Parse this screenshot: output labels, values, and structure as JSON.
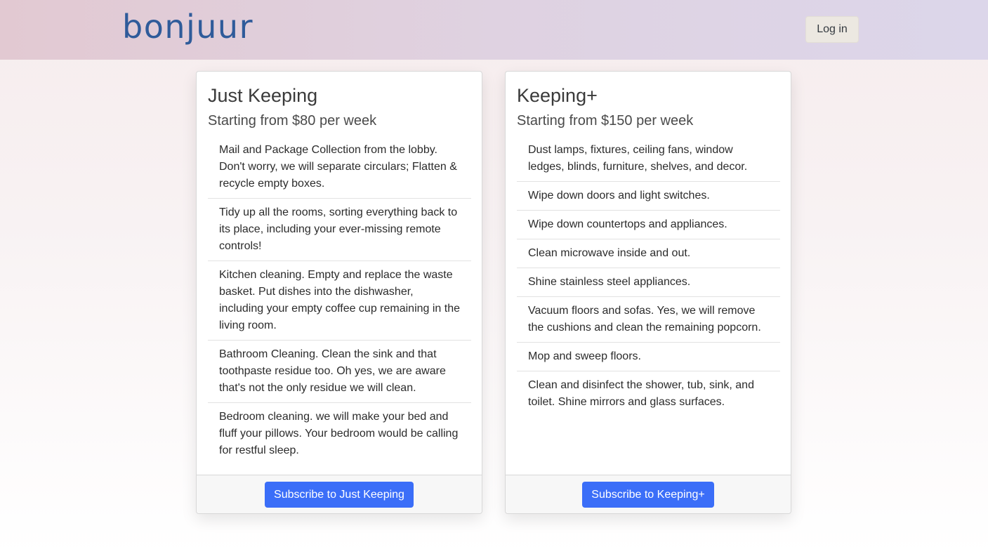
{
  "header": {
    "logo_text": "bonjuur",
    "login_label": "Log in"
  },
  "plans": [
    {
      "title": "Just Keeping",
      "subtitle": "Starting from $80 per week",
      "features": [
        "Mail and Package Collection from the lobby. Don't worry, we will separate circulars; Flatten & recycle empty boxes.",
        "Tidy up all the rooms, sorting everything back to its place, including your ever-missing remote controls!",
        "Kitchen cleaning. Empty and replace the waste basket. Put dishes into the dishwasher, including your empty coffee cup remaining in the living room.",
        "Bathroom Cleaning. Clean the sink and that toothpaste residue too. Oh yes, we are aware that's not the only residue we will clean.",
        "Bedroom cleaning. we will make your bed and fluff your pillows. Your bedroom would be calling for restful sleep."
      ],
      "button_label": "Subscribe to Just Keeping"
    },
    {
      "title": "Keeping+",
      "subtitle": "Starting from $150 per week",
      "features": [
        "Dust lamps, fixtures, ceiling fans, window ledges, blinds, furniture, shelves, and decor.",
        "Wipe down doors and light switches.",
        "Wipe down countertops and appliances.",
        "Clean microwave inside and out.",
        "Shine stainless steel appliances.",
        "Vacuum floors and sofas. Yes, we will remove the cushions and clean the remaining popcorn.",
        "Mop and sweep floors.",
        "Clean and disinfect the shower, tub, sink, and toilet. Shine mirrors and glass surfaces."
      ],
      "button_label": "Subscribe to Keeping+"
    }
  ],
  "colors": {
    "brand": "#2f5b9a",
    "primary_button": "#3b6ef8",
    "login_button": "#ece8e1"
  }
}
